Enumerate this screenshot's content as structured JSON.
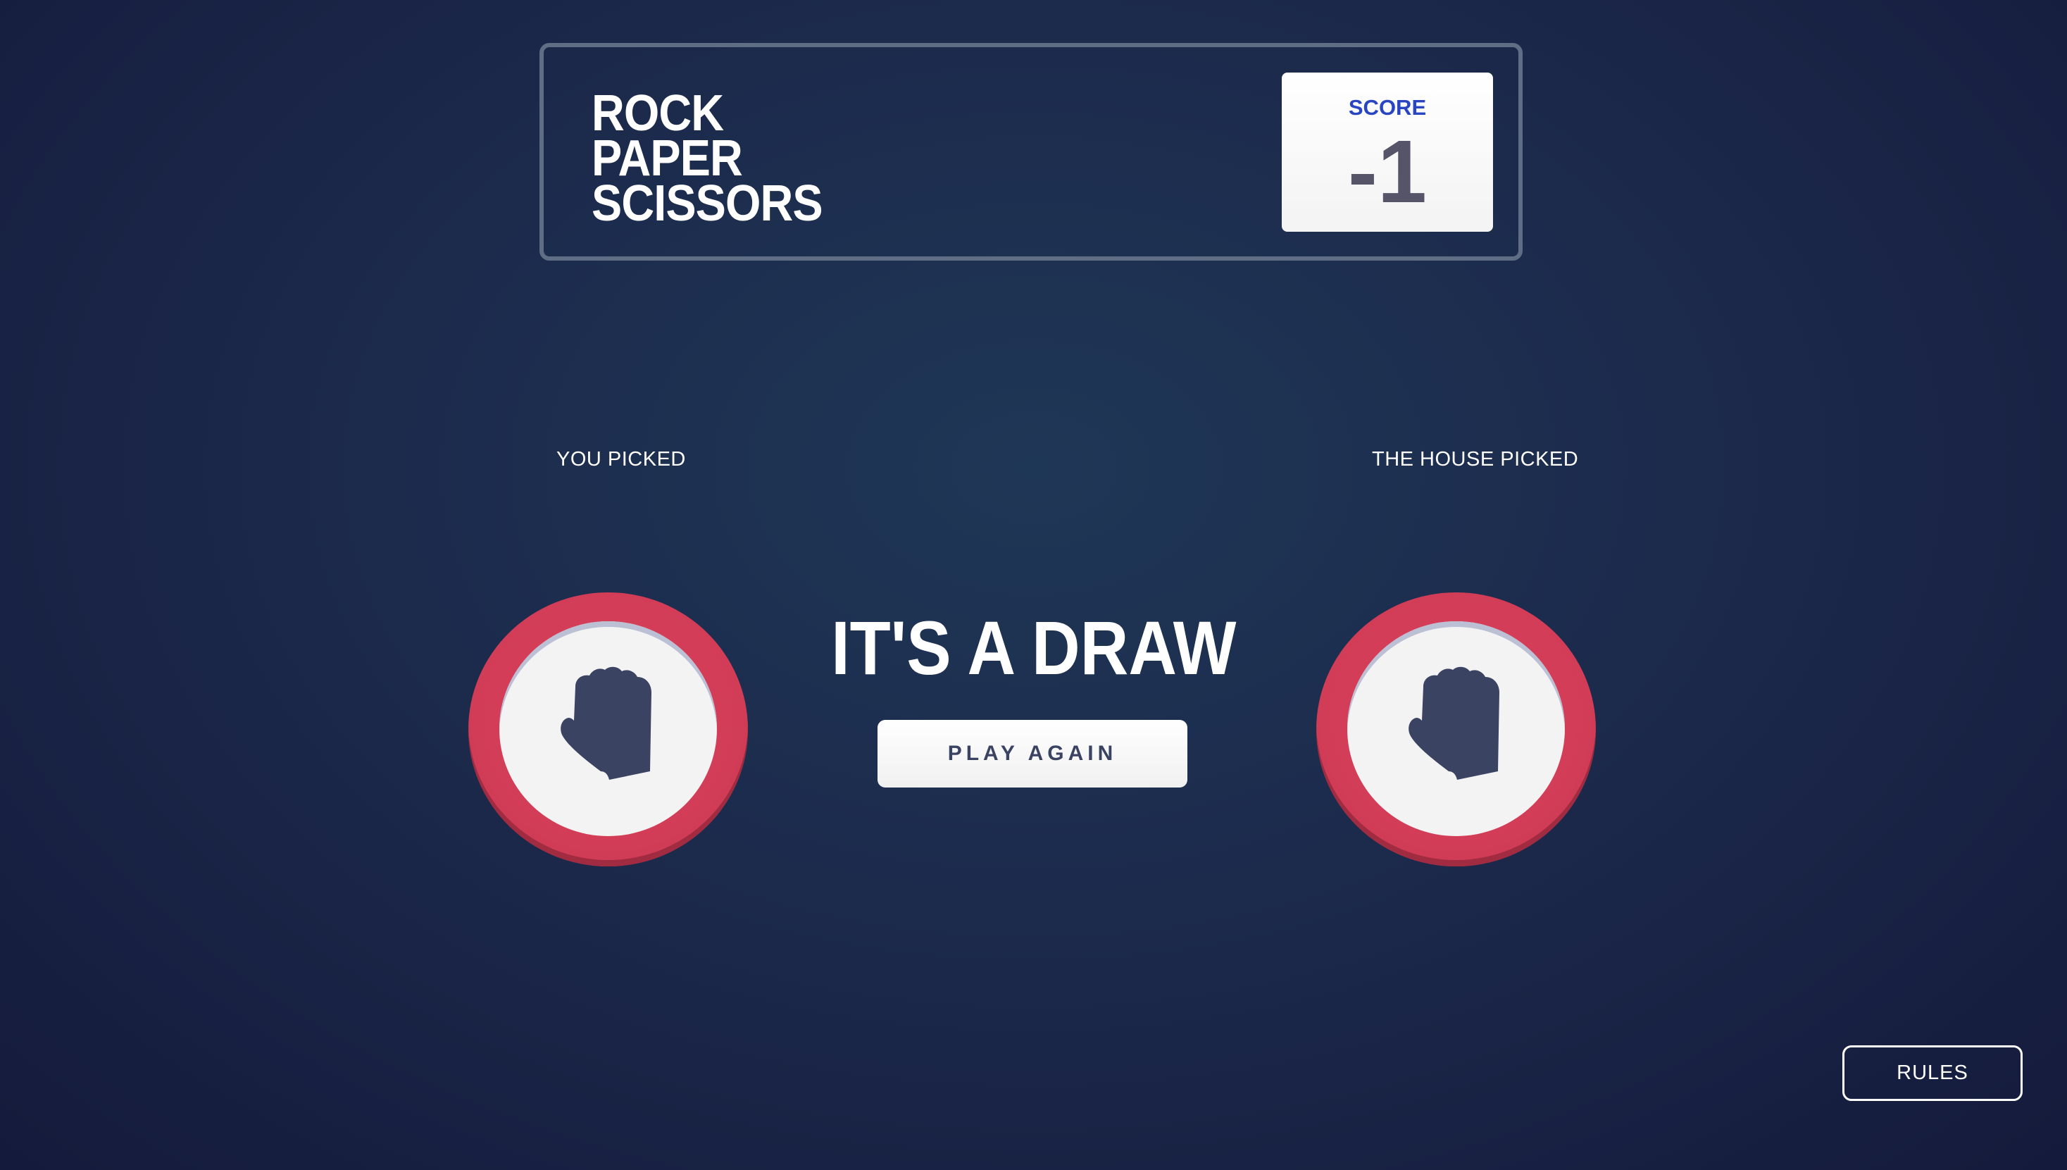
{
  "header": {
    "title_lines": [
      "ROCK",
      "PAPER",
      "SCISSORS"
    ],
    "score_label": "SCORE",
    "score_value": "-1"
  },
  "player": {
    "label": "YOU PICKED",
    "choice": "rock",
    "icon": "rock-fist-icon"
  },
  "house": {
    "label": "THE HOUSE PICKED",
    "choice": "rock",
    "icon": "rock-fist-icon"
  },
  "result": {
    "text": "IT'S A DRAW",
    "play_again_label": "PLAY AGAIN"
  },
  "footer": {
    "rules_label": "RULES"
  },
  "colors": {
    "background": "#1c2a4c",
    "rock_ring": "#dc2e4e",
    "score_label": "#2a45c2",
    "score_value": "#565468",
    "icon_fill": "#3b4363"
  }
}
